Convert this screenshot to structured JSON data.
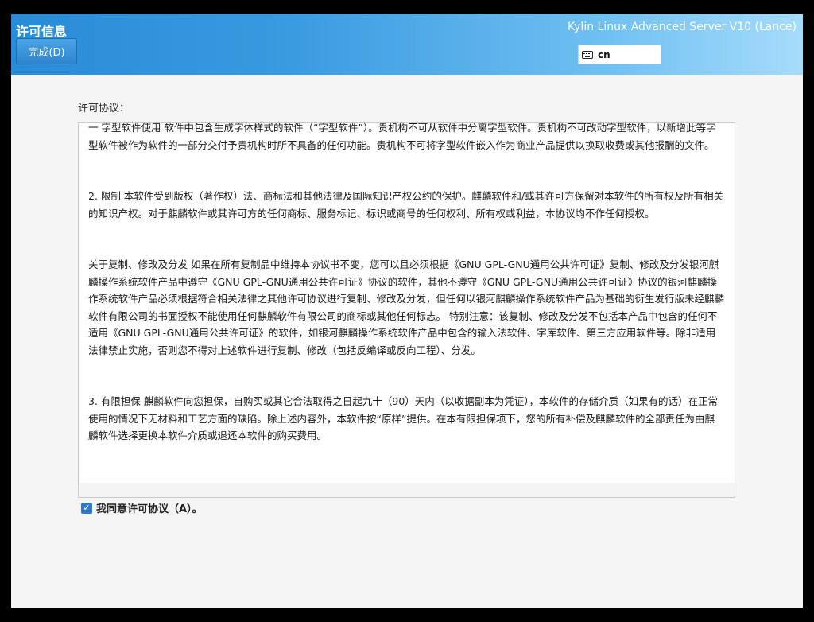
{
  "header": {
    "title": "许可信息",
    "done_label": "完成(D)",
    "product": "Kylin Linux Advanced Server V10 (Lance)",
    "keyboard_layout": "cn"
  },
  "license": {
    "label": "许可协议：",
    "paragraphs": [
      "一 字型软件使用 软件中包含生成字体样式的软件（“字型软件”）。贵机构不可从软件中分离字型软件。贵机构不可改动字型软件，以新增此等字型软件被作为软件的一部分交付予贵机构时所不具备的任何功能。贵机构不可将字型软件嵌入作为商业产品提供以换取收费或其他报酬的文件。",
      "2. 限制 本软件受到版权（著作权）法、商标法和其他法律及国际知识产权公约的保护。麒麟软件和/或其许可方保留对本软件的所有权及所有相关的知识产权。对于麒麟软件或其许可方的任何商标、服务标记、标识或商号的任何权利、所有权或利益，本协议均不作任何授权。",
      "关于复制、修改及分发 如果在所有复制品中维持本协议书不变，您可以且必须根据《GNU GPL-GNU通用公共许可证》复制、修改及分发银河麒麟操作系统软件产品中遵守《GNU GPL-GNU通用公共许可证》协议的软件，其他不遵守《GNU GPL-GNU通用公共许可证》协议的银河麒麟操作系统软件产品必须根据符合相关法律之其他许可协议进行复制、修改及分发，但任何以银河麒麟操作系统软件产品为基础的衍生发行版未经麒麟软件有限公司的书面授权不能使用任何麒麟软件有限公司的商标或其他任何标志。 特别注意：该复制、修改及分发不包括本产品中包含的任何不适用《GNU GPL-GNU通用公共许可证》的软件，如银河麒麟操作系统软件产品中包含的输入法软件、字库软件、第三方应用软件等。除非适用法律禁止实施，否则您不得对上述软件进行复制、修改（包括反编译或反向工程）、分发。",
      "3. 有限担保 麒麟软件向您担保，自购买或其它合法取得之日起九十（90）天内（以收据副本为凭证），本软件的存储介质（如果有的话）在正常使用的情况下无材料和工艺方面的缺陷。除上述内容外，本软件按“原样”提供。在本有限担保项下，您的所有补偿及麒麟软件的全部责任为由麒麟软件选择更换本软件介质或退还本软件的购买费用。"
    ]
  },
  "agree": {
    "label": "我同意许可协议（A）。",
    "checked": true
  }
}
